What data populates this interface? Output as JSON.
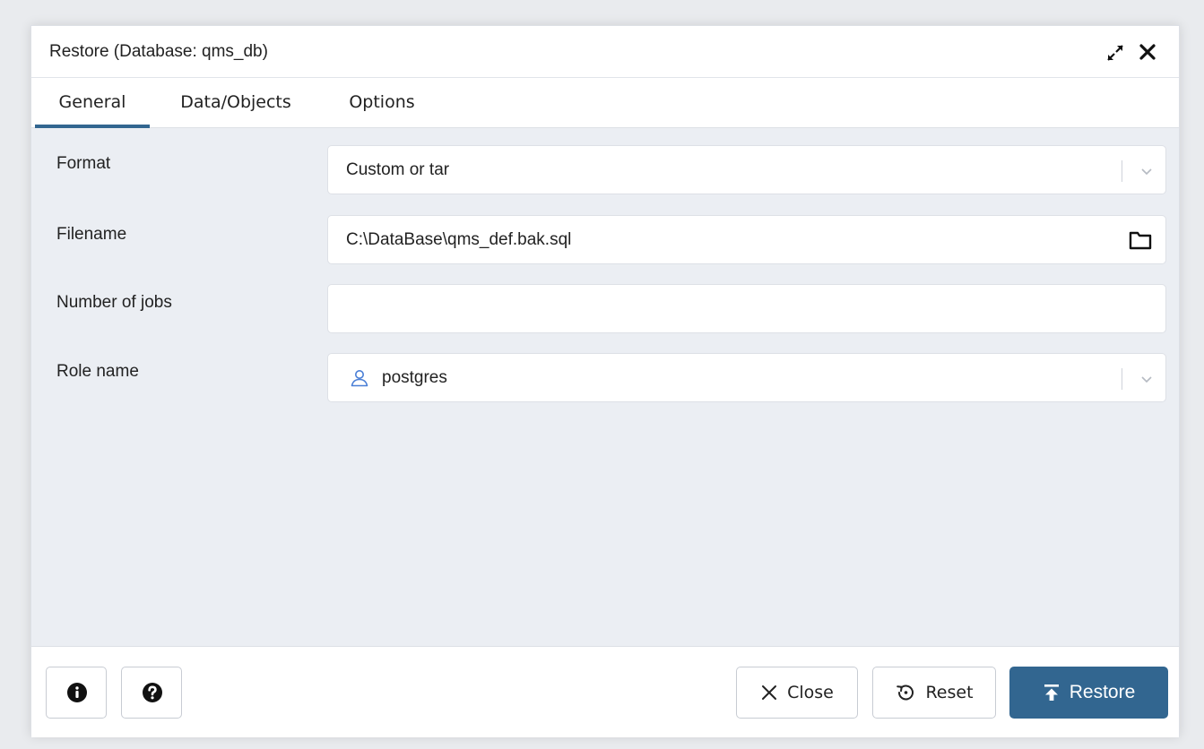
{
  "dialog": {
    "title": "Restore (Database: qms_db)",
    "expand_icon": "expand-icon",
    "close_icon": "close-icon"
  },
  "tabs": [
    {
      "label": "General",
      "active": true
    },
    {
      "label": "Data/Objects",
      "active": false
    },
    {
      "label": "Options",
      "active": false
    }
  ],
  "form": {
    "format": {
      "label": "Format",
      "value": "Custom or tar"
    },
    "filename": {
      "label": "Filename",
      "value": "C:\\DataBase\\qms_def.bak.sql"
    },
    "jobs": {
      "label": "Number of jobs",
      "value": ""
    },
    "role": {
      "label": "Role name",
      "value": "postgres"
    }
  },
  "footer": {
    "info_icon": "info-icon",
    "help_icon": "help-icon",
    "close_label": "Close",
    "reset_label": "Reset",
    "restore_label": "Restore"
  },
  "colors": {
    "accent": "#326690",
    "background": "#ebeef3",
    "user_icon": "#4a7fd6"
  }
}
